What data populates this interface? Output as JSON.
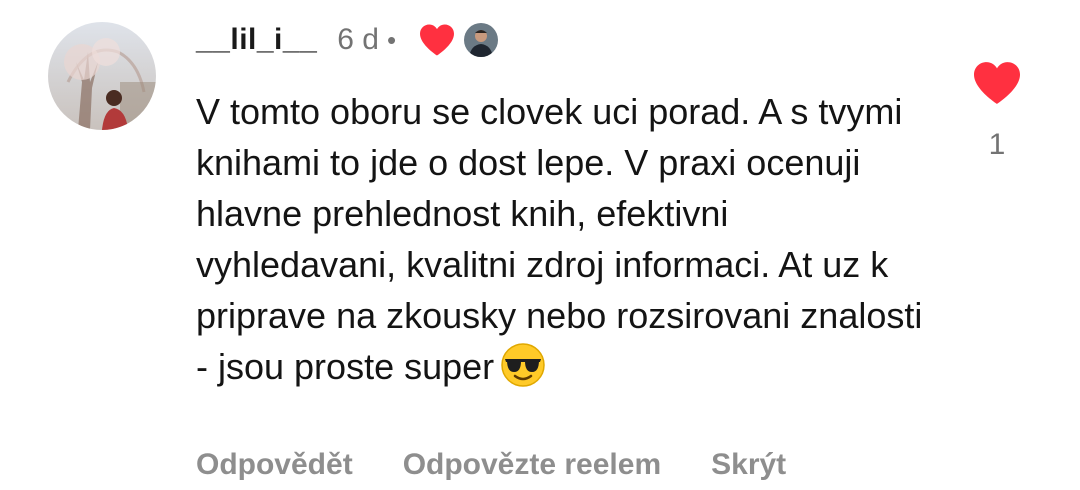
{
  "comment": {
    "username": "__lil_i__",
    "time_ago": "6 d",
    "separator": "•",
    "creator_liked_icon": "heart-icon",
    "creator_avatar_icon": "creator-avatar",
    "text": "V tomto oboru se clovek uci porad. A s tvymi knihami to jde o dost lepe. V praxi ocenuji hlavne prehlednost knih, efektivni vyhledavani, kvalitni zdroj informaci. At uz k priprave na zkousky nebo rozsirovani znalosti - jsou proste super",
    "emoji": "smiling-face-with-sunglasses",
    "like_icon": "heart-icon",
    "like_count": "1",
    "accent_color": "#ff3040",
    "actions": {
      "reply": "Odpovědět",
      "reply_with_reel": "Odpovězte reelem",
      "hide": "Skrýt"
    }
  }
}
